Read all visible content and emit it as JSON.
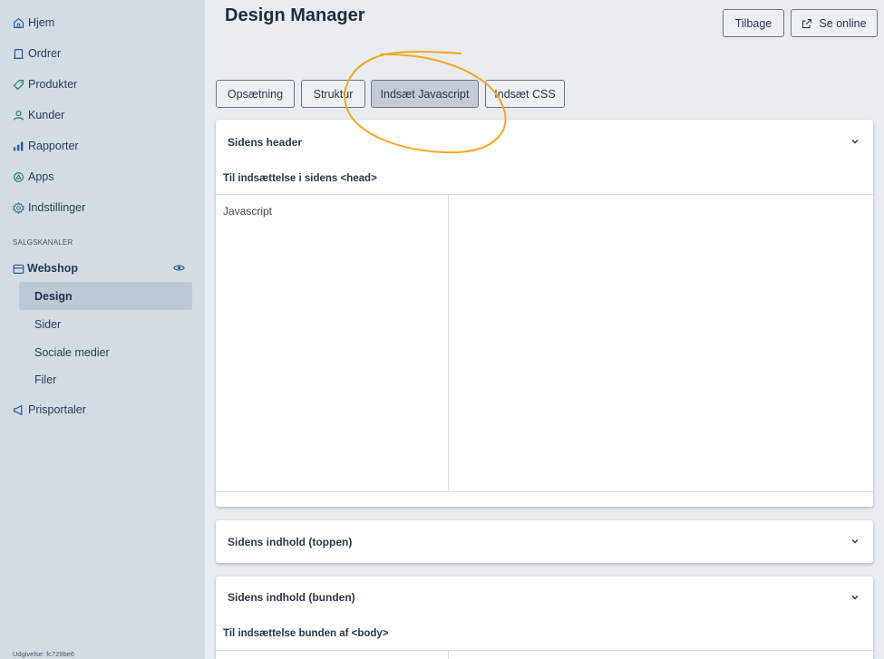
{
  "sidebar": {
    "items": [
      {
        "label": "Hjem",
        "icon": "home-icon"
      },
      {
        "label": "Ordrer",
        "icon": "orders-icon"
      },
      {
        "label": "Produkter",
        "icon": "tag-icon"
      },
      {
        "label": "Kunder",
        "icon": "user-icon"
      },
      {
        "label": "Rapporter",
        "icon": "bar-chart-icon"
      },
      {
        "label": "Apps",
        "icon": "apps-icon"
      },
      {
        "label": "Indstillinger",
        "icon": "gear-icon"
      }
    ],
    "section_label": "SALGSKANALER",
    "webshop": {
      "label": "Webshop",
      "sub_items": [
        "Design",
        "Sider",
        "Sociale medier",
        "Filer"
      ],
      "active": "Design"
    },
    "pricing": {
      "label": "Prisportaler"
    },
    "release": "Udgivelse: fc729be6"
  },
  "header": {
    "title": "Design Manager",
    "back_label": "Tilbage",
    "online_label": "Se online"
  },
  "tabs": [
    "Opsætning",
    "Struktur",
    "Indsæt Javascript",
    "Indsæt CSS"
  ],
  "active_tab": "Indsæt Javascript",
  "sections": {
    "header": {
      "title": "Sidens header",
      "subtitle": "Til indsættelse i sidens <head>",
      "editor_label": "Javascript"
    },
    "top": {
      "title": "Sidens indhold (toppen)"
    },
    "bottom": {
      "title": "Sidens indhold (bunden)",
      "subtitle": "Til indsættelse bunden af <body>"
    }
  },
  "colors": {
    "accent": "#2c5aa0",
    "annotation": "#f5a623",
    "sidebar_bg": "#d3dbe3",
    "page_bg": "#e9edf2"
  }
}
